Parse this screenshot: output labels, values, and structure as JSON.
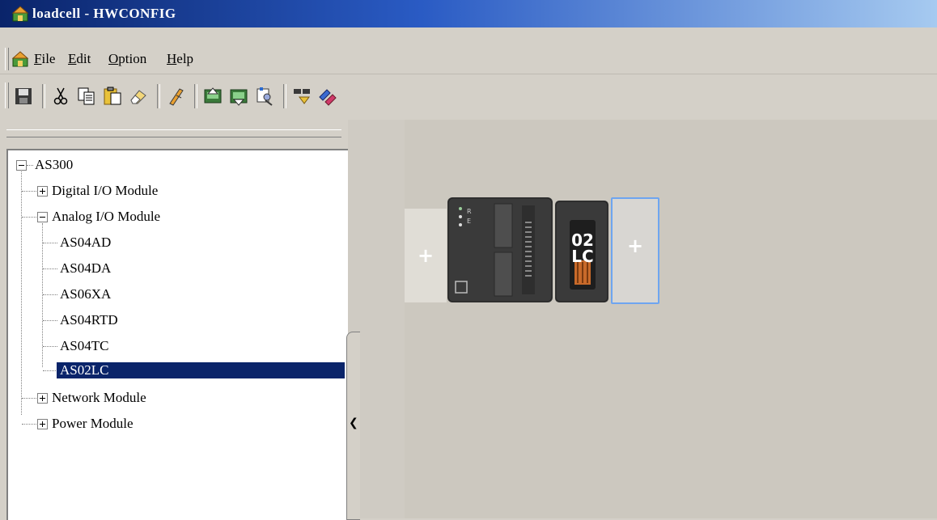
{
  "window": {
    "title": "loadcell - HWCONFIG",
    "app_icon": "hwconfig-icon"
  },
  "menu": {
    "items": [
      "File",
      "Edit",
      "Option",
      "Help"
    ],
    "accel": [
      "F",
      "E",
      "O",
      "H"
    ]
  },
  "toolbar": {
    "buttons": [
      "save-icon",
      "cut-icon",
      "copy-icon",
      "paste-icon",
      "eraser-icon",
      "wand-icon",
      "upload-icon",
      "download-icon",
      "scan-icon",
      "online-icon",
      "connect-icon"
    ]
  },
  "tree": {
    "root": "AS300",
    "groups": [
      {
        "label": "Digital I/O Module",
        "expanded": false
      },
      {
        "label": "Analog I/O Module",
        "expanded": true,
        "children": [
          "AS04AD",
          "AS04DA",
          "AS06XA",
          "AS04RTD",
          "AS04TC",
          "AS02LC"
        ],
        "selected": "AS02LC"
      },
      {
        "label": "Network Module",
        "expanded": false
      },
      {
        "label": "Power Module",
        "expanded": false
      }
    ]
  },
  "rack": {
    "empty_slot_symbol": "+",
    "module_label_top": "02",
    "module_label_bottom": "LC",
    "next_slot_symbol": "+"
  }
}
